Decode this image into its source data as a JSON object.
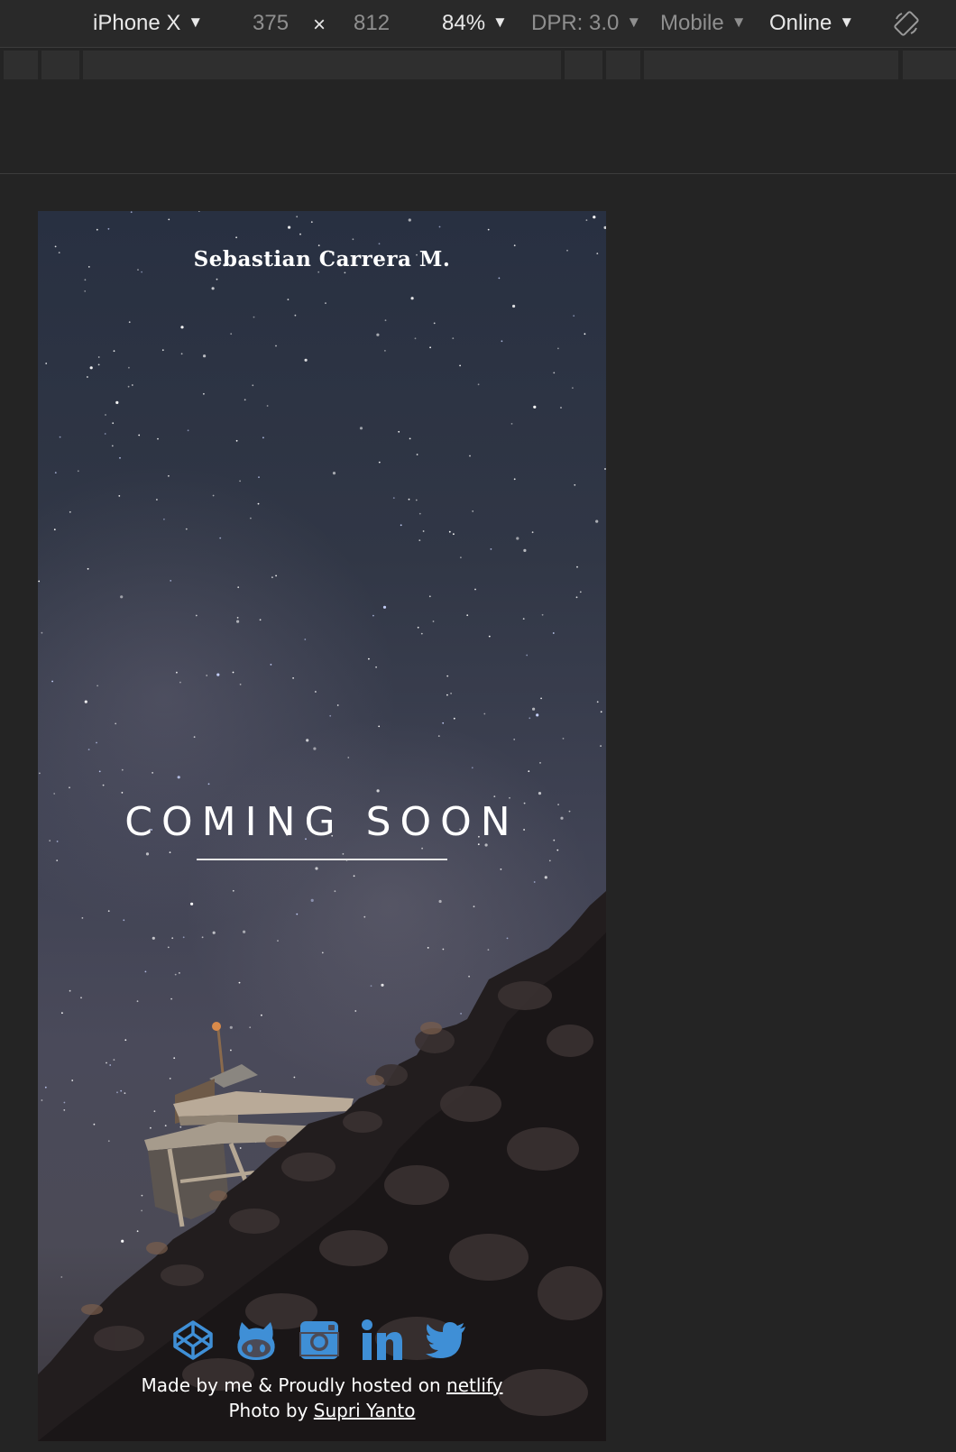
{
  "devtools": {
    "device": "iPhone X",
    "width": "375",
    "separator": "×",
    "height": "812",
    "zoom": "84%",
    "dpr": "DPR: 3.0",
    "mode": "Mobile",
    "network": "Online",
    "arrow": "▼",
    "rotate_icon": "rotate-icon"
  },
  "page": {
    "site_title": "Sebastian Carrera M.",
    "headline": "COMING SOON",
    "social_icons": [
      "codepen-icon",
      "github-icon",
      "instagram-icon",
      "linkedin-icon",
      "twitter-icon"
    ],
    "accent_color": "#3f8fd6",
    "footer": {
      "made_by": "Made by me & Proudly hosted on ",
      "host_link": "netlify",
      "photo_by": "Photo by ",
      "photographer_link": "Supri Yanto"
    }
  }
}
